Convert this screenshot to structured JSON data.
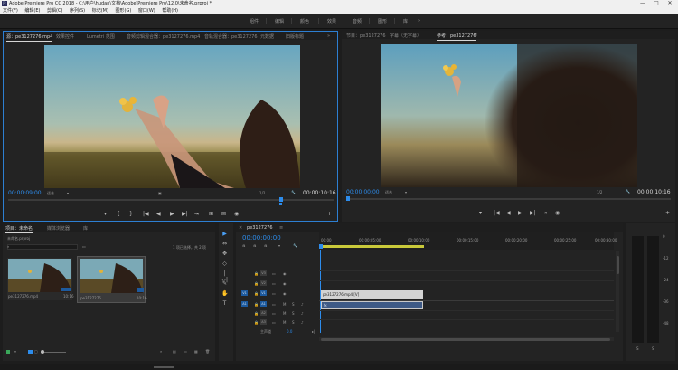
{
  "window": {
    "title": "Adobe Premiere Pro CC 2018 - C:\\用户\\hudan\\文档\\Adobe\\Premiere Pro\\12.0\\未命名.prproj *",
    "controls": [
      "—",
      "□",
      "✕"
    ]
  },
  "menu": [
    "文件(F)",
    "编辑(E)",
    "剪辑(C)",
    "序列(S)",
    "标记(M)",
    "图形(G)",
    "窗口(W)",
    "帮助(H)"
  ],
  "workspaces": [
    "组件",
    "编辑",
    "颜色",
    "效果",
    "音频",
    "图形",
    "库",
    "»"
  ],
  "source_monitor": {
    "tabs": [
      "源：pe3127276.mp4",
      "效果控件",
      "Lumetri 范围",
      "音频剪辑混合器：pe3127276.mp4",
      "音轨混合器：pe3127276",
      "元数据",
      "旧版标题"
    ],
    "more": "»",
    "timecode_in": "00:00:09:00",
    "fit": "适合",
    "res": "1/2",
    "timecode_dur": "00:00:10:16",
    "controls": [
      "▾",
      "{",
      "}",
      "|◀",
      "◀",
      "▶",
      "▶|",
      "⇥",
      "⊞",
      "⊟",
      "◉"
    ],
    "plus": "+"
  },
  "program_monitor": {
    "tabs": [
      "节目：pe3127276",
      "字幕（无字幕）",
      "参考：pe3127276"
    ],
    "timecode_in": "00:00:00:00",
    "fit": "适合",
    "res": "1/2",
    "timecode_dur": "00:00:10:16",
    "controls": [
      "▾",
      "|◀",
      "◀",
      "▶",
      "▶|",
      "⇥",
      "◉"
    ],
    "plus": "+"
  },
  "project": {
    "tabs": [
      "项目：未命名",
      "媒体浏览器",
      "库"
    ],
    "path": "未命名.prproj",
    "status": "1 项已选择，共 2 项",
    "clips": [
      {
        "name": "pe3127276.mp4",
        "dur": "10:16"
      },
      {
        "name": "pe3127276",
        "dur": "10:16"
      }
    ]
  },
  "timeline": {
    "tab": "pe3127276",
    "timecode": "00:00:00:00",
    "ruler": [
      "00:00",
      "00:00:05:00",
      "00:00:10:00",
      "00:00:15:00",
      "00:00:20:00",
      "00:00:25:00",
      "00:00:30:00"
    ],
    "video_tracks": [
      "V3",
      "V2",
      "V1"
    ],
    "audio_tracks": [
      "A1",
      "A2",
      "A3"
    ],
    "master": "主声道",
    "master_val": "0.0",
    "clip_label": "pe3127276.mp4 [V]",
    "audio_clip_label": "fx"
  },
  "meter": {
    "scale": [
      "0",
      "-12",
      "-24",
      "-36",
      "-48"
    ],
    "labels": [
      "S",
      "S"
    ]
  },
  "tools": [
    "▶",
    "⇔",
    "✥",
    "◇",
    "|↔|",
    "✎",
    "✋",
    "T"
  ]
}
